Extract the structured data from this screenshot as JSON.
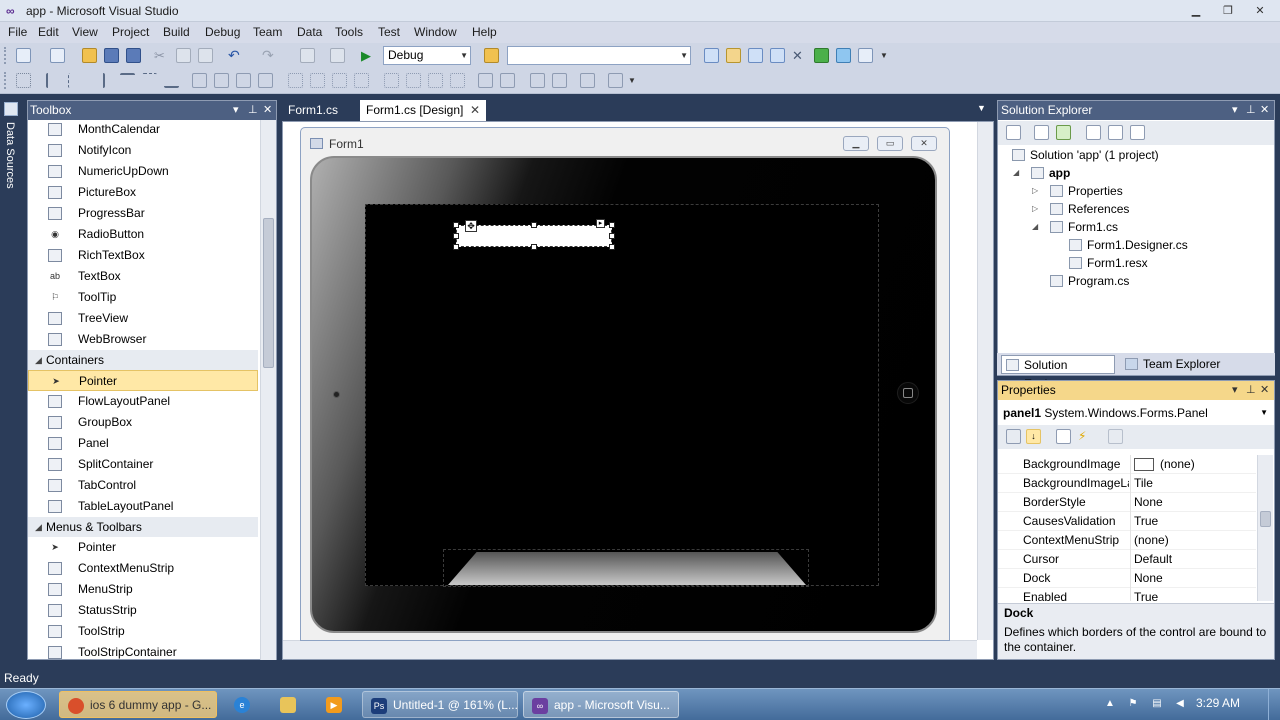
{
  "window": {
    "title": "app - Microsoft Visual Studio"
  },
  "menu": [
    "File",
    "Edit",
    "View",
    "Project",
    "Build",
    "Debug",
    "Team",
    "Data",
    "Tools",
    "Test",
    "Window",
    "Help"
  ],
  "toolbar": {
    "config": "Debug",
    "platform": ""
  },
  "side_strip": {
    "label": "Data Sources"
  },
  "toolbox": {
    "title": "Toolbox",
    "items_top": [
      {
        "label": "MonthCalendar",
        "icon": "month-calendar-icon"
      },
      {
        "label": "NotifyIcon",
        "icon": "notify-icon"
      },
      {
        "label": "NumericUpDown",
        "icon": "numeric-updown-icon"
      },
      {
        "label": "PictureBox",
        "icon": "picturebox-icon"
      },
      {
        "label": "ProgressBar",
        "icon": "progressbar-icon"
      },
      {
        "label": "RadioButton",
        "icon": "radiobutton-icon"
      },
      {
        "label": "RichTextBox",
        "icon": "richtextbox-icon"
      },
      {
        "label": "TextBox",
        "icon": "textbox-icon"
      },
      {
        "label": "ToolTip",
        "icon": "tooltip-icon"
      },
      {
        "label": "TreeView",
        "icon": "treeview-icon"
      },
      {
        "label": "WebBrowser",
        "icon": "webbrowser-icon"
      }
    ],
    "cat_containers": "Containers",
    "items_containers": [
      {
        "label": "Pointer",
        "icon": "pointer-icon"
      },
      {
        "label": "FlowLayoutPanel",
        "icon": "flowlayoutpanel-icon"
      },
      {
        "label": "GroupBox",
        "icon": "groupbox-icon"
      },
      {
        "label": "Panel",
        "icon": "panel-icon"
      },
      {
        "label": "SplitContainer",
        "icon": "splitcontainer-icon"
      },
      {
        "label": "TabControl",
        "icon": "tabcontrol-icon"
      },
      {
        "label": "TableLayoutPanel",
        "icon": "tablelayoutpanel-icon"
      }
    ],
    "cat_menus": "Menus & Toolbars",
    "items_menus": [
      {
        "label": "Pointer",
        "icon": "pointer-icon"
      },
      {
        "label": "ContextMenuStrip",
        "icon": "contextmenustrip-icon"
      },
      {
        "label": "MenuStrip",
        "icon": "menustrip-icon"
      },
      {
        "label": "StatusStrip",
        "icon": "statusstrip-icon"
      },
      {
        "label": "ToolStrip",
        "icon": "toolstrip-icon"
      },
      {
        "label": "ToolStripContainer",
        "icon": "toolstripcontainer-icon"
      }
    ]
  },
  "tabs": [
    {
      "label": "Form1.cs",
      "active": false
    },
    {
      "label": "Form1.cs [Design]",
      "active": true
    }
  ],
  "designer": {
    "form_title": "Form1"
  },
  "solution_explorer": {
    "title": "Solution Explorer",
    "rows": [
      {
        "label": "Solution 'app' (1 project)",
        "indent": 0,
        "toggle": ""
      },
      {
        "label": "app",
        "indent": 1,
        "toggle": "◢",
        "bold": true
      },
      {
        "label": "Properties",
        "indent": 2,
        "toggle": "▷"
      },
      {
        "label": "References",
        "indent": 2,
        "toggle": "▷"
      },
      {
        "label": "Form1.cs",
        "indent": 2,
        "toggle": "◢"
      },
      {
        "label": "Form1.Designer.cs",
        "indent": 3,
        "toggle": ""
      },
      {
        "label": "Form1.resx",
        "indent": 3,
        "toggle": ""
      },
      {
        "label": "Program.cs",
        "indent": 2,
        "toggle": ""
      }
    ],
    "tab_solution": "Solution Explorer",
    "tab_team": "Team Explorer"
  },
  "properties": {
    "title": "Properties",
    "object_name": "panel1",
    "object_type": "System.Windows.Forms.Panel",
    "rows": [
      {
        "name": "BackgroundImage",
        "value": "(none)"
      },
      {
        "name": "BackgroundImageLayout",
        "value": "Tile"
      },
      {
        "name": "BorderStyle",
        "value": "None"
      },
      {
        "name": "CausesValidation",
        "value": "True"
      },
      {
        "name": "ContextMenuStrip",
        "value": "(none)"
      },
      {
        "name": "Cursor",
        "value": "Default"
      },
      {
        "name": "Dock",
        "value": "None"
      },
      {
        "name": "Enabled",
        "value": "True"
      }
    ],
    "desc_title": "Dock",
    "desc_text": "Defines which borders of the control are bound to the container."
  },
  "status": "Ready",
  "taskbar": {
    "buttons": [
      {
        "label": "ios 6 dummy app - G...",
        "icon": "chrome-icon",
        "color": "#d94f2b"
      },
      {
        "label": "Untitled-1 @ 161% (L...",
        "icon": "photoshop-icon",
        "color": "#1c3d7a"
      },
      {
        "label": "app - Microsoft Visu...",
        "icon": "visual-studio-icon",
        "color": "#6b3fa0"
      }
    ],
    "clock": "3:29 AM"
  }
}
